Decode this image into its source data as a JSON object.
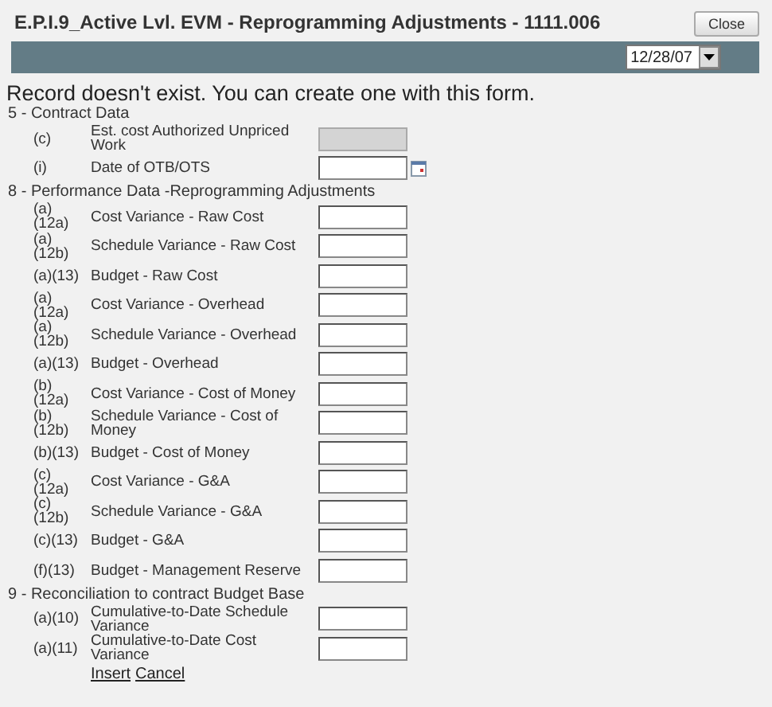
{
  "window": {
    "title": "E.P.I.9_Active Lvl. EVM - Reprogramming Adjustments - 1111.006",
    "close_button": "Close"
  },
  "toolbar": {
    "date_select": {
      "value": "12/28/07"
    }
  },
  "message": "Record doesn't exist. You can create one with this form.",
  "sections": [
    {
      "title": "5 - Contract Data",
      "rows": [
        {
          "code": "(c)",
          "label": "Est. cost Authorized Unpriced Work",
          "kind": "text",
          "disabled": true
        },
        {
          "code": "(i)",
          "label": "Date of OTB/OTS",
          "kind": "date",
          "disabled": false
        }
      ]
    },
    {
      "title": "8 - Performance Data -Reprogramming Adjustments",
      "rows": [
        {
          "code": "(a) (12a)",
          "label": "Cost Variance - Raw Cost",
          "kind": "text",
          "disabled": false
        },
        {
          "code": "(a) (12b)",
          "label": "Schedule Variance - Raw Cost",
          "kind": "text",
          "disabled": false
        },
        {
          "code": "(a)(13)",
          "label": "Budget - Raw Cost",
          "kind": "text",
          "disabled": false
        },
        {
          "code": "(a) (12a)",
          "label": "Cost Variance - Overhead",
          "kind": "text",
          "disabled": false
        },
        {
          "code": "(a) (12b)",
          "label": "Schedule Variance - Overhead",
          "kind": "text",
          "disabled": false
        },
        {
          "code": "(a)(13)",
          "label": "Budget - Overhead",
          "kind": "text",
          "disabled": false
        },
        {
          "code": "(b) (12a)",
          "label": "Cost Variance - Cost of Money",
          "kind": "text",
          "disabled": false
        },
        {
          "code": "(b) (12b)",
          "label": "Schedule Variance - Cost of Money",
          "kind": "text",
          "disabled": false
        },
        {
          "code": "(b)(13)",
          "label": "Budget - Cost of Money",
          "kind": "text",
          "disabled": false
        },
        {
          "code": "(c) (12a)",
          "label": "Cost Variance - G&A",
          "kind": "text",
          "disabled": false
        },
        {
          "code": "(c) (12b)",
          "label": "Schedule Variance - G&A",
          "kind": "text",
          "disabled": false
        },
        {
          "code": "(c)(13)",
          "label": "Budget - G&A",
          "kind": "text",
          "disabled": false
        },
        {
          "code": "(f)(13)",
          "label": "Budget - Management Reserve",
          "kind": "text",
          "disabled": false
        }
      ]
    },
    {
      "title": "9 - Reconciliation to contract Budget Base",
      "rows": [
        {
          "code": "(a)(10)",
          "label": "Cumulative-to-Date Schedule Variance",
          "kind": "text",
          "disabled": false
        },
        {
          "code": "(a)(11)",
          "label": "Cumulative-to-Date Cost Variance",
          "kind": "text",
          "disabled": false
        }
      ]
    }
  ],
  "links": [
    "Insert",
    "Cancel"
  ]
}
